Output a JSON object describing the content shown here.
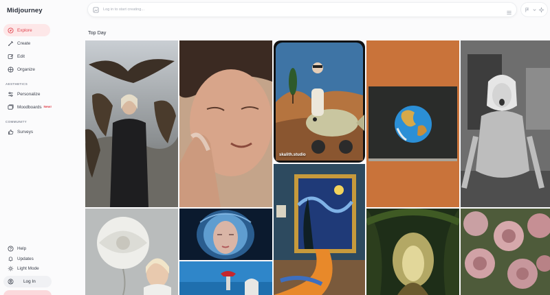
{
  "app": {
    "name": "Midjourney"
  },
  "nav": {
    "explore": "Explore",
    "create": "Create",
    "edit": "Edit",
    "organize": "Organize",
    "aesthetics_label": "AESTHETICS",
    "personalize": "Personalize",
    "moodboards": "Moodboards",
    "new_badge": "New!",
    "community_label": "COMMUNITY",
    "surveys": "Surveys",
    "help": "Help",
    "updates": "Updates",
    "light_mode": "Light Mode",
    "login": "Log In"
  },
  "search": {
    "placeholder": "Log in to start creating..."
  },
  "main": {
    "section_title": "Top Day",
    "tiles": [
      {
        "name": "owls-woman"
      },
      {
        "name": "face-cream"
      },
      {
        "name": "fish-rider",
        "caption": "skalith.studio"
      },
      {
        "name": "earth-painting"
      },
      {
        "name": "cartoon-woman"
      },
      {
        "name": "white-flowers"
      },
      {
        "name": "glass-face"
      },
      {
        "name": "starry-night-museum"
      },
      {
        "name": "forest-path"
      },
      {
        "name": "peonies"
      },
      {
        "name": "sky-figure"
      }
    ]
  },
  "colors": {
    "accent": "#e0454f",
    "active_bg": "#fde7e8"
  }
}
